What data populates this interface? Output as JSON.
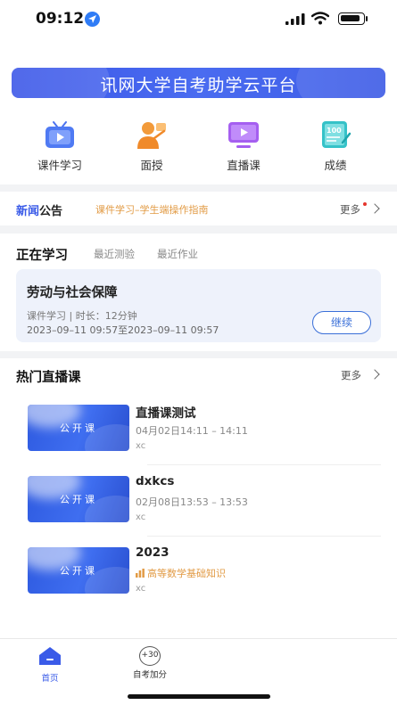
{
  "status_bar": {
    "time": "09:12"
  },
  "banner": {
    "title": "讯网大学自考助学云平台"
  },
  "nav": [
    {
      "label": "课件学习",
      "icon": "tv-icon"
    },
    {
      "label": "面授",
      "icon": "teacher-icon"
    },
    {
      "label": "直播课",
      "icon": "play-screen-icon"
    },
    {
      "label": "成绩",
      "icon": "score-icon"
    }
  ],
  "news": {
    "tag_blue": "新闻",
    "tag_dark": "公告",
    "link": "课件学习–学生端操作指南",
    "more": "更多"
  },
  "learning": {
    "tab_active": "正在学习",
    "tab_exam": "最近测验",
    "tab_homework": "最近作业",
    "course": {
      "title": "劳动与社会保障",
      "meta": "课件学习 | 时长：12分钟",
      "time": "2023–09–11 09:57至2023–09–11 09:57",
      "button": "继续"
    }
  },
  "live": {
    "title": "热门直播课",
    "more": "更多",
    "items": [
      {
        "thumb": "公开课",
        "name": "直播课测试",
        "time": "04月02日14:11 – 14:11",
        "teacher": "xc"
      },
      {
        "thumb": "公开课",
        "name": "dxkcs",
        "time": "02月08日13:53 – 13:53",
        "teacher": "xc"
      },
      {
        "thumb": "公开课",
        "name": "2023",
        "subject": "高等数学基础知识",
        "teacher": "xc"
      }
    ]
  },
  "tabbar": {
    "home": "首页",
    "bonus_badge": "+30",
    "bonus": "自考加分"
  },
  "colors": {
    "accent": "#3a5be8",
    "link_orange": "#e29b45"
  }
}
